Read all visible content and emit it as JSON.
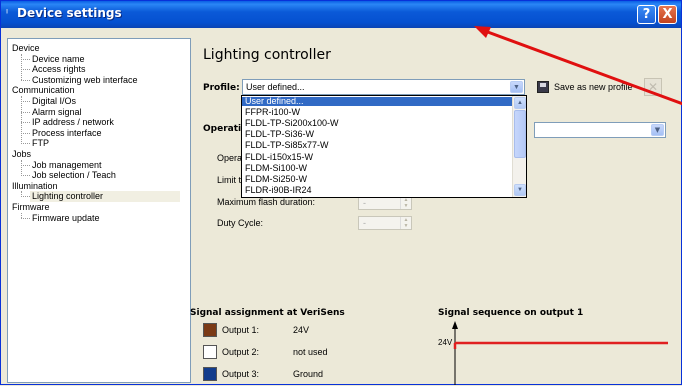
{
  "window": {
    "title": "Device settings",
    "help_label": "?",
    "close_label": "X"
  },
  "tree": {
    "categories": [
      {
        "label": "Device",
        "children": [
          "Device name",
          "Access rights",
          "Customizing web interface"
        ]
      },
      {
        "label": "Communication",
        "children": [
          "Digital I/Os",
          "Alarm signal",
          "IP address / network",
          "Process interface",
          "FTP"
        ]
      },
      {
        "label": "Jobs",
        "children": [
          "Job management",
          "Job selection / Teach"
        ]
      },
      {
        "label": "Illumination",
        "children": [
          "Lighting controller"
        ]
      },
      {
        "label": "Firmware",
        "children": [
          "Firmware update"
        ]
      }
    ],
    "selected": "Lighting controller"
  },
  "main": {
    "title": "Lighting controller",
    "profile_label": "Profile:",
    "profile_value": "User defined...",
    "save_label": "Save as new profile",
    "operating_label": "Operati",
    "fields": [
      {
        "label": "Opera",
        "value": ""
      },
      {
        "label": "Limit th",
        "value": ""
      },
      {
        "label": "Maximum flash duration:",
        "value": "-"
      },
      {
        "label": "Duty Cycle:",
        "value": "-"
      }
    ],
    "profile_options": [
      "User defined...",
      "FFPR-i100-W",
      "FLDL-TP-Si200x100-W",
      "FLDL-TP-Si36-W",
      "FLDL-TP-Si85x77-W",
      "FLDL-i150x15-W",
      "FLDM-Si100-W",
      "FLDM-Si250-W",
      "FLDR-i90B-IR24"
    ]
  },
  "signal": {
    "title": "Signal assignment at VeriSens",
    "outputs": [
      {
        "label": "Output 1:",
        "value": "24V",
        "color": "#7b3a16"
      },
      {
        "label": "Output 2:",
        "value": "not used",
        "color": "#ffffff"
      },
      {
        "label": "Output 3:",
        "value": "Ground",
        "color": "#123c8c"
      }
    ]
  },
  "sequence": {
    "title": "Signal sequence on output 1",
    "level_label": "24V",
    "line_color": "#e02020"
  },
  "annotation": {
    "arrow_color": "#e01010"
  }
}
